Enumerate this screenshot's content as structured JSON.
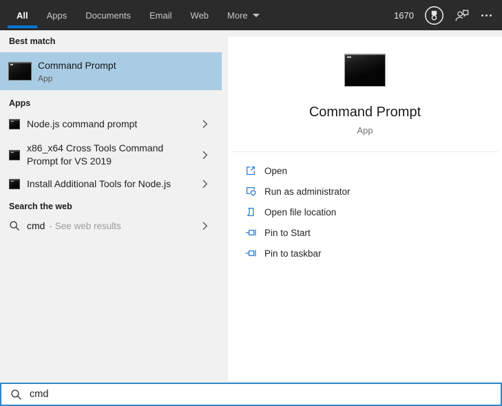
{
  "topbar": {
    "tabs": [
      {
        "label": "All",
        "active": true
      },
      {
        "label": "Apps",
        "active": false
      },
      {
        "label": "Documents",
        "active": false
      },
      {
        "label": "Email",
        "active": false
      },
      {
        "label": "Web",
        "active": false
      },
      {
        "label": "More",
        "active": false
      }
    ],
    "rewards_points": "1670"
  },
  "left_panel": {
    "best_match": {
      "header": "Best match",
      "title": "Command Prompt",
      "subtitle": "App"
    },
    "apps": {
      "header": "Apps",
      "items": [
        {
          "label": "Node.js command prompt"
        },
        {
          "label": "x86_x64 Cross Tools Command Prompt for VS 2019"
        },
        {
          "label": "Install Additional Tools for Node.js"
        }
      ]
    },
    "web": {
      "header": "Search the web",
      "query": "cmd",
      "suffix": "- See web results"
    }
  },
  "preview": {
    "title": "Command Prompt",
    "subtitle": "App",
    "actions": [
      {
        "label": "Open",
        "icon": "open-icon"
      },
      {
        "label": "Run as administrator",
        "icon": "admin-shield-icon"
      },
      {
        "label": "Open file location",
        "icon": "file-location-icon"
      },
      {
        "label": "Pin to Start",
        "icon": "pin-icon"
      },
      {
        "label": "Pin to taskbar",
        "icon": "pin-icon"
      }
    ]
  },
  "searchbox": {
    "value": "cmd"
  },
  "colors": {
    "topbar_bg": "#2b2b2b",
    "accent_blue": "#0078d7",
    "highlight_blue": "#a9cce5",
    "panel_bg": "#f1f1f1",
    "action_icon_blue": "#2b7cd3",
    "search_border": "#2f86c9"
  }
}
